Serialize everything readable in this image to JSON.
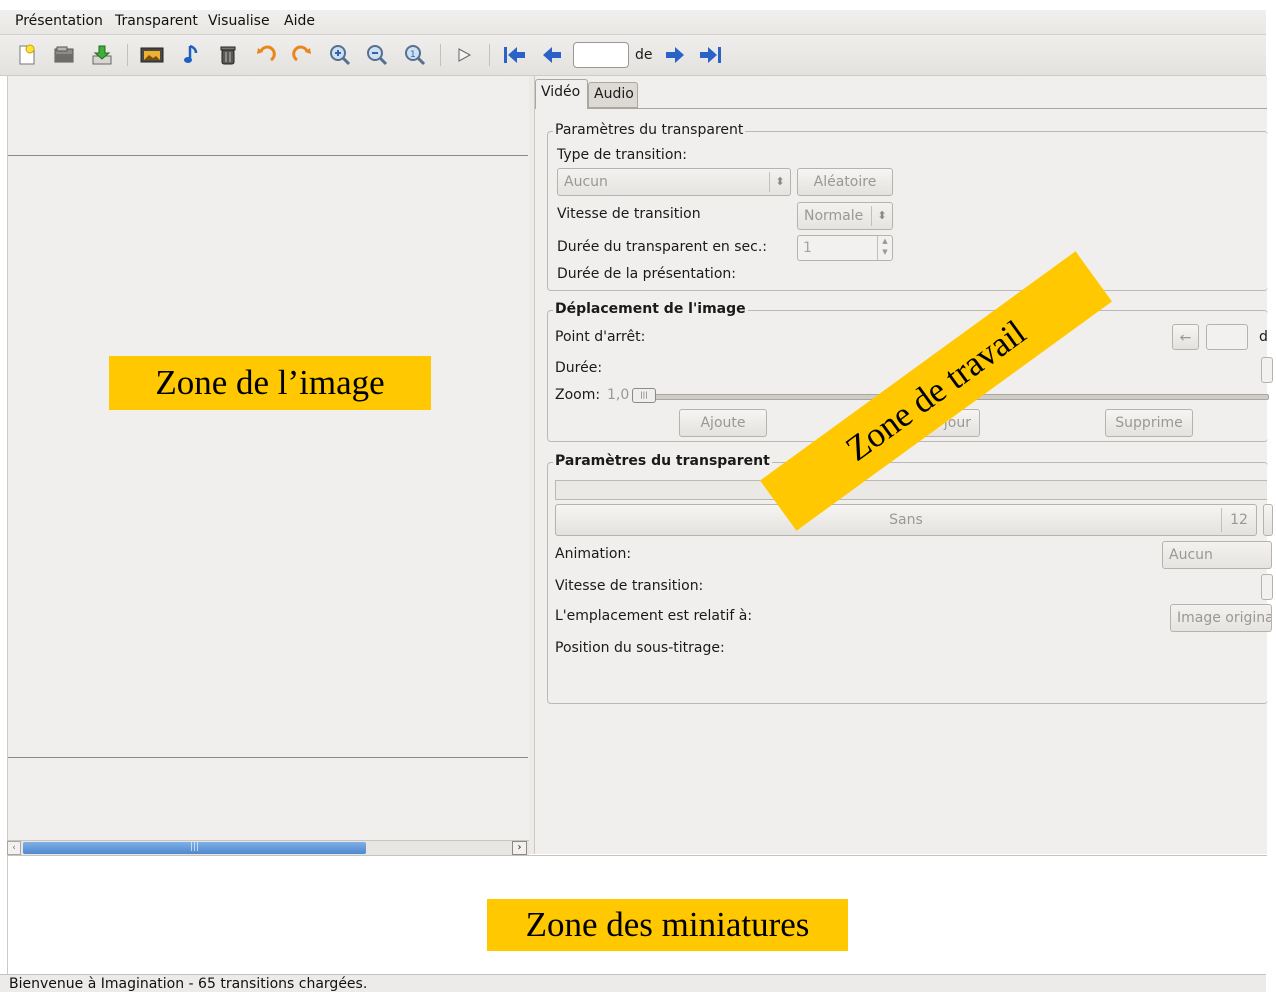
{
  "menu": [
    "Présentation",
    "Transparent",
    "Visualise",
    "Aide"
  ],
  "toolbar": {
    "page_value": "",
    "page_of_label": "de",
    "icons": [
      "new-slideshow-icon",
      "open-slideshow-icon",
      "save-slideshow-icon",
      "import-pictures-icon",
      "import-music-icon",
      "delete-icon",
      "rotate-left-icon",
      "rotate-right-icon",
      "zoom-in-icon",
      "zoom-out-icon",
      "zoom-normal-icon",
      "preview-play-icon",
      "first-slide-icon",
      "previous-slide-icon",
      "next-slide-icon",
      "last-slide-icon"
    ]
  },
  "tabs": {
    "video": "Vidéo",
    "audio": "Audio"
  },
  "slide_settings": {
    "title": "Paramètres du transparent",
    "transition_type_label": "Type de transition:",
    "transition_type_value": "Aucun",
    "random_button": "Aléatoire",
    "transition_speed_label": "Vitesse de transition",
    "transition_speed_value": "Normale",
    "duration_label": "Durée du transparent en sec.:",
    "duration_value": "1",
    "presentation_duration_label": "Durée de la présentation:"
  },
  "image_motion": {
    "title": "Déplacement de l'image",
    "stop_point_label": "Point d'arrêt:",
    "stop_point_of": "d",
    "duration_label": "Durée:",
    "zoom_label": "Zoom:",
    "zoom_value": "1,0",
    "add_button": "Ajoute",
    "update_button": "à jour",
    "remove_button": "Supprime"
  },
  "slide_text": {
    "title": "Paramètres du transparent",
    "font_button": "Sans",
    "font_size": "12",
    "animation_label": "Animation:",
    "animation_value": "Aucun",
    "speed_label": "Vitesse de transition:",
    "placement_label": "L'emplacement est relatif à:",
    "placement_value": "Image origina",
    "subtitle_position_label": "Position du sous-titrage:"
  },
  "status": "Bienvenue à Imagination - 65 transitions chargées.",
  "annotations": {
    "image_zone": "Zone de l’image",
    "work_zone": "Zone de travail",
    "thumbnails_zone": "Zone des miniatures"
  },
  "colors": {
    "annotation_bg": "#ffc800",
    "scroll_thumb": "#5b93d6",
    "nav_arrows": "#2a62c8"
  }
}
